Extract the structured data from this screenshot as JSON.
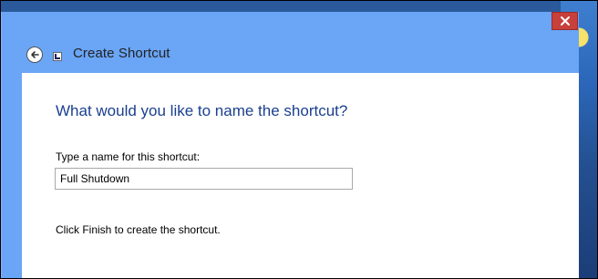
{
  "window": {
    "title": "Create Shortcut",
    "back_icon": "back-arrow-icon",
    "app_icon": "shortcut-icon",
    "close_icon": "close-icon"
  },
  "page": {
    "question": "What would you like to name the shortcut?",
    "name_label": "Type a name for this shortcut:",
    "name_value": "Full Shutdown",
    "hint": "Click Finish to create the shortcut."
  },
  "colors": {
    "chrome": "#6aa5f6",
    "close_button": "#c7403b",
    "heading": "#1a3f8f"
  }
}
